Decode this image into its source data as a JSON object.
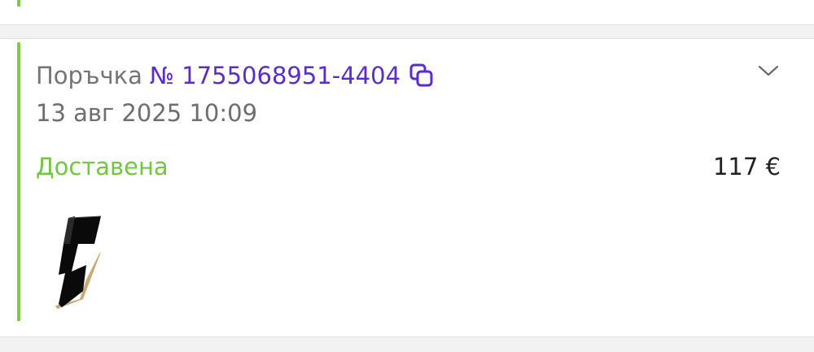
{
  "order": {
    "label": "Поръчка",
    "number": "№ 1755068951-4404",
    "date": "13 авг 2025 10:09",
    "status": "Доставена",
    "total": "117 €"
  },
  "icons": {
    "copy": "copy-icon",
    "expand": "chevron-down-icon",
    "product": "product-thumbnail"
  },
  "colors": {
    "accent_green": "#7dcb4a",
    "status_green": "#74c446",
    "order_number": "#5a2dc9",
    "muted_text": "#757575"
  }
}
